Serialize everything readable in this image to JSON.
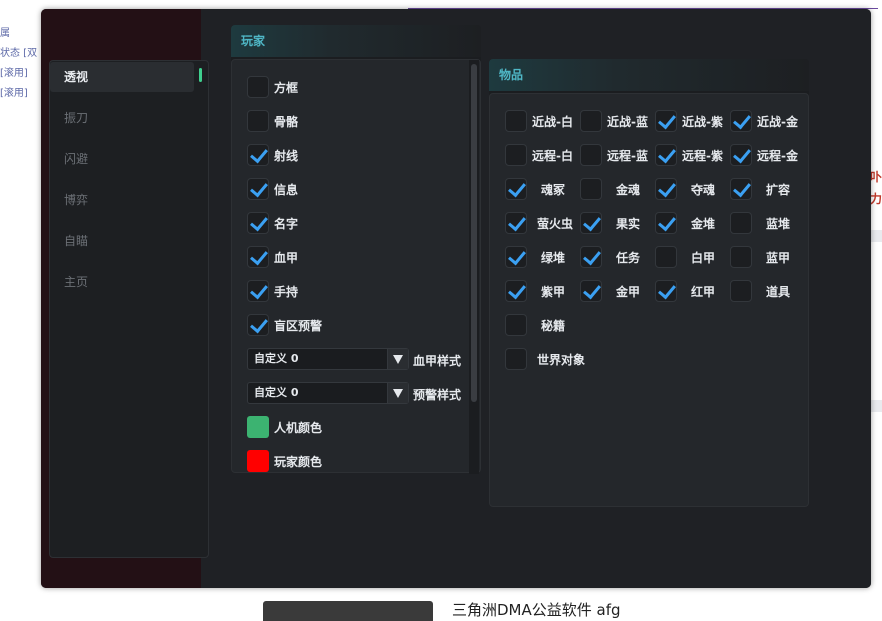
{
  "background": {
    "article_title": "三角洲DMA公益软件 afg",
    "left_texts": [
      "属",
      "状态 [双",
      "[滚用]",
      "[滚用]"
    ],
    "right_texts": [
      "卟",
      "力"
    ]
  },
  "sidebar": {
    "items": [
      {
        "label": "透视",
        "active": true
      },
      {
        "label": "振刀",
        "active": false
      },
      {
        "label": "闪避",
        "active": false
      },
      {
        "label": "博弈",
        "active": false
      },
      {
        "label": "自瞄",
        "active": false
      },
      {
        "label": "主页",
        "active": false
      }
    ]
  },
  "player_panel": {
    "title": "玩家",
    "options": [
      {
        "label": "方框",
        "checked": false
      },
      {
        "label": "骨骼",
        "checked": false
      },
      {
        "label": "射线",
        "checked": true
      },
      {
        "label": "信息",
        "checked": true
      },
      {
        "label": "名字",
        "checked": true
      },
      {
        "label": "血甲",
        "checked": true
      },
      {
        "label": "手持",
        "checked": true
      },
      {
        "label": "盲区预警",
        "checked": true
      }
    ],
    "dropdowns": [
      {
        "value": "自定义 0",
        "label": "血甲样式"
      },
      {
        "value": "自定义 0",
        "label": "预警样式"
      }
    ],
    "colors": [
      {
        "label": "人机颜色",
        "color": "#3cb371"
      },
      {
        "label": "玩家颜色",
        "color": "#ff0000"
      }
    ]
  },
  "items_panel": {
    "title": "物品",
    "rows": [
      [
        {
          "label": "近战-白",
          "checked": false
        },
        {
          "label": "近战-蓝",
          "checked": false
        },
        {
          "label": "近战-紫",
          "checked": true
        },
        {
          "label": "近战-金",
          "checked": true
        }
      ],
      [
        {
          "label": "远程-白",
          "checked": false
        },
        {
          "label": "远程-蓝",
          "checked": false
        },
        {
          "label": "远程-紫",
          "checked": true
        },
        {
          "label": "远程-金",
          "checked": true
        }
      ],
      [
        {
          "label": "魂冢",
          "checked": true
        },
        {
          "label": "金魂",
          "checked": false
        },
        {
          "label": "夺魂",
          "checked": true
        },
        {
          "label": "扩容",
          "checked": true
        }
      ],
      [
        {
          "label": "萤火虫",
          "checked": true
        },
        {
          "label": "果实",
          "checked": true
        },
        {
          "label": "金堆",
          "checked": true
        },
        {
          "label": "蓝堆",
          "checked": false
        }
      ],
      [
        {
          "label": "绿堆",
          "checked": true
        },
        {
          "label": "任务",
          "checked": true
        },
        {
          "label": "白甲",
          "checked": false
        },
        {
          "label": "蓝甲",
          "checked": false
        }
      ],
      [
        {
          "label": "紫甲",
          "checked": true
        },
        {
          "label": "金甲",
          "checked": true
        },
        {
          "label": "红甲",
          "checked": true
        },
        {
          "label": "道具",
          "checked": false
        }
      ],
      [
        {
          "label": "秘籍",
          "checked": false
        }
      ],
      [
        {
          "label": "世界对象",
          "checked": false
        }
      ]
    ]
  },
  "colors": {
    "accent_check": "#3ba0f2",
    "accent_green": "#3fcf8e",
    "header_teal": "#4fb7c6"
  }
}
